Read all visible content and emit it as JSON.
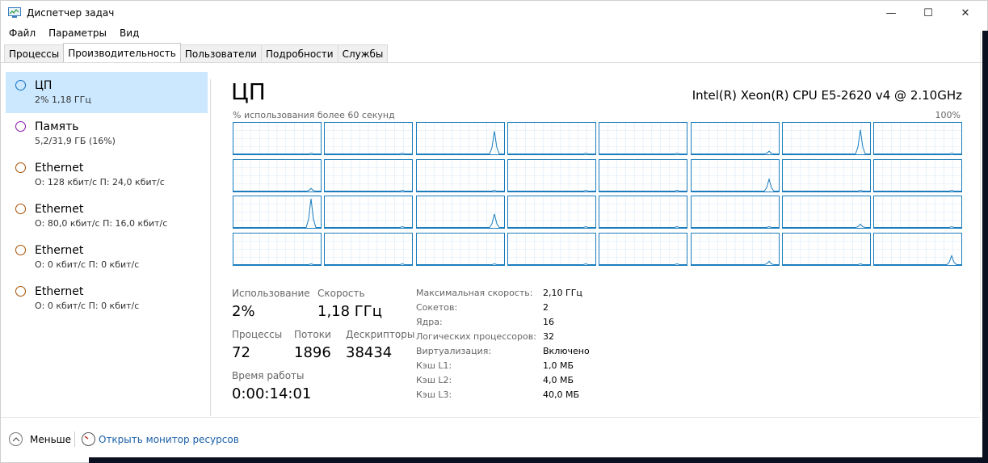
{
  "window": {
    "title": "Диспетчер задач",
    "minimize_glyph": "—",
    "maximize_glyph": "☐",
    "close_glyph": "✕",
    "icon": "task-manager-icon"
  },
  "menu": [
    "Файл",
    "Параметры",
    "Вид"
  ],
  "tabs": [
    {
      "label": "Процессы",
      "active": false
    },
    {
      "label": "Производительность",
      "active": true
    },
    {
      "label": "Пользователи",
      "active": false
    },
    {
      "label": "Подробности",
      "active": false
    },
    {
      "label": "Службы",
      "active": false
    }
  ],
  "sidebar": {
    "items": [
      {
        "name": "ЦП",
        "sub": "2% 1,18 ГГц",
        "color": "#1170c1",
        "selected": true
      },
      {
        "name": "Память",
        "sub": "5,2/31,9 ГБ (16%)",
        "color": "#8b12ae",
        "selected": false
      },
      {
        "name": "Ethernet",
        "sub": "О: 128 кбит/с П: 24,0 кбит/с",
        "color": "#a74f01",
        "selected": false
      },
      {
        "name": "Ethernet",
        "sub": "О: 80,0 кбит/с П: 16,0 кбит/с",
        "color": "#a74f01",
        "selected": false
      },
      {
        "name": "Ethernet",
        "sub": "О: 0 кбит/с П: 0 кбит/с",
        "color": "#a74f01",
        "selected": false
      },
      {
        "name": "Ethernet",
        "sub": "О: 0 кбит/с П: 0 кбит/с",
        "color": "#a74f01",
        "selected": false
      }
    ]
  },
  "main": {
    "title": "ЦП",
    "cpu_model": "Intel(R) Xeon(R) CPU E5-2620 v4 @ 2.10GHz",
    "graph_label": "% использования более 60 секунд",
    "graph_max": "100%",
    "graph_color": "#1b7dbd",
    "grid_color": "#d9eaf7",
    "stats": {
      "usage_label": "Использование",
      "usage_value": "2%",
      "speed_label": "Скорость",
      "speed_value": "1,18 ГГц",
      "processes_label": "Процессы",
      "processes_value": "72",
      "threads_label": "Потоки",
      "threads_value": "1896",
      "handles_label": "Дескрипторы",
      "handles_value": "38434",
      "uptime_label": "Время работы",
      "uptime_value": "0:00:14:01"
    },
    "specs": [
      {
        "label": "Максимальная скорость:",
        "value": "2,10 ГГц"
      },
      {
        "label": "Сокетов:",
        "value": "2"
      },
      {
        "label": "Ядра:",
        "value": "16"
      },
      {
        "label": "Логических процессоров:",
        "value": "32"
      },
      {
        "label": "Виртуализация:",
        "value": "Включено"
      },
      {
        "label": "Кэш L1:",
        "value": "1,0 МБ"
      },
      {
        "label": "Кэш L2:",
        "value": "4,0 МБ"
      },
      {
        "label": "Кэш L3:",
        "value": "40,0 МБ"
      }
    ]
  },
  "footer": {
    "less_label": "Меньше",
    "monitor_link": "Открыть монитор ресурсов"
  }
}
